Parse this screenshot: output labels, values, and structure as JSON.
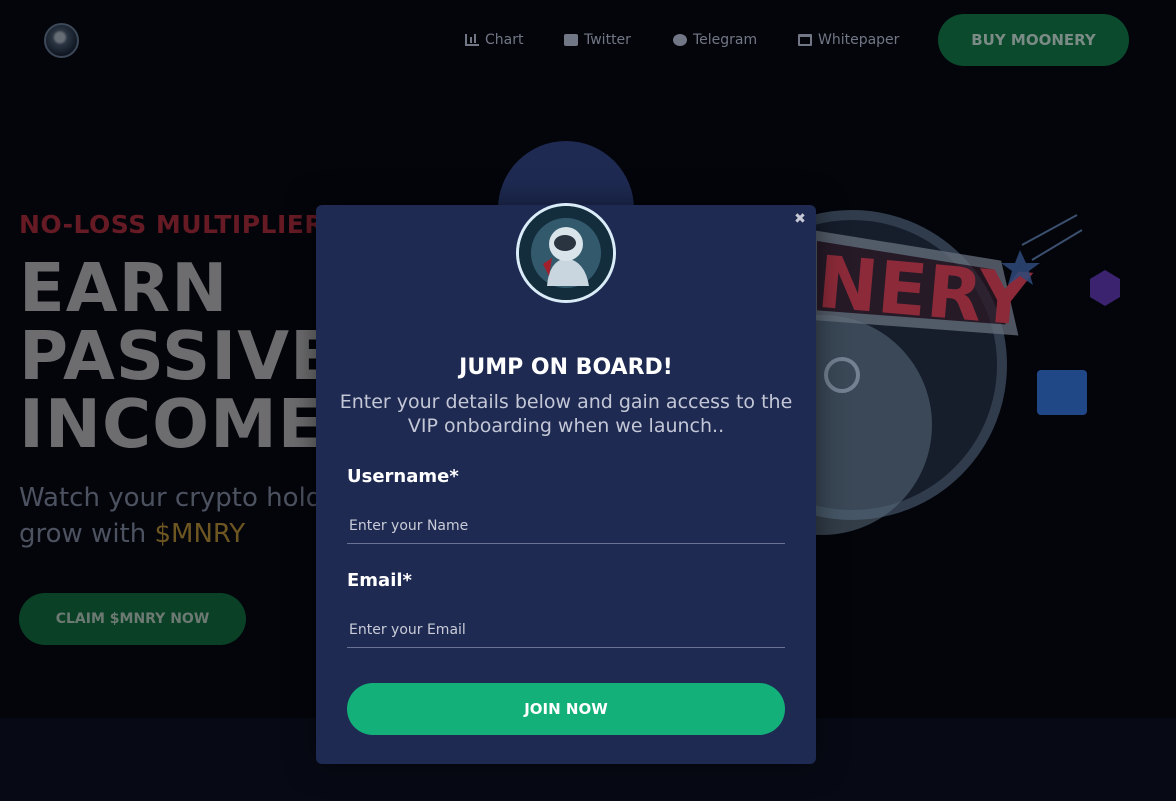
{
  "nav": {
    "logo_icon": "astronaut-logo-icon",
    "items": [
      {
        "label": "Chart",
        "icon": "bar-chart-icon"
      },
      {
        "label": "Twitter",
        "icon": "twitter-icon"
      },
      {
        "label": "Telegram",
        "icon": "telegram-icon"
      },
      {
        "label": "Whitepaper",
        "icon": "book-icon"
      }
    ],
    "buy_label": "BUY MOONERY"
  },
  "hero": {
    "kicker": "NO-LOSS MULTIPLIER",
    "title_lines": [
      "EARN",
      "PASSIVE",
      "INCOME"
    ],
    "subtitle_prefix": "Watch your crypto holdi",
    "subtitle_line2_prefix": "grow with ",
    "subtitle_accent": "$MNRY",
    "cta_label": "CLAIM $MNRY NOW",
    "mascot_text": "NERY"
  },
  "modal": {
    "close_symbol": "✖",
    "heading": "JUMP ON BOARD!",
    "description": "Enter your details below and gain access to the VIP onboarding when we launch..",
    "username_label": "Username*",
    "username_placeholder": "Enter your Name",
    "username_value": "",
    "email_label": "Email*",
    "email_placeholder": "Enter your Email",
    "email_value": "",
    "submit_label": "JOIN NOW"
  },
  "colors": {
    "background": "#03050b",
    "modal": "#1e2a52",
    "accent_green": "#13b07a",
    "kicker_red": "#661a24",
    "token_gold": "#6e5622"
  }
}
